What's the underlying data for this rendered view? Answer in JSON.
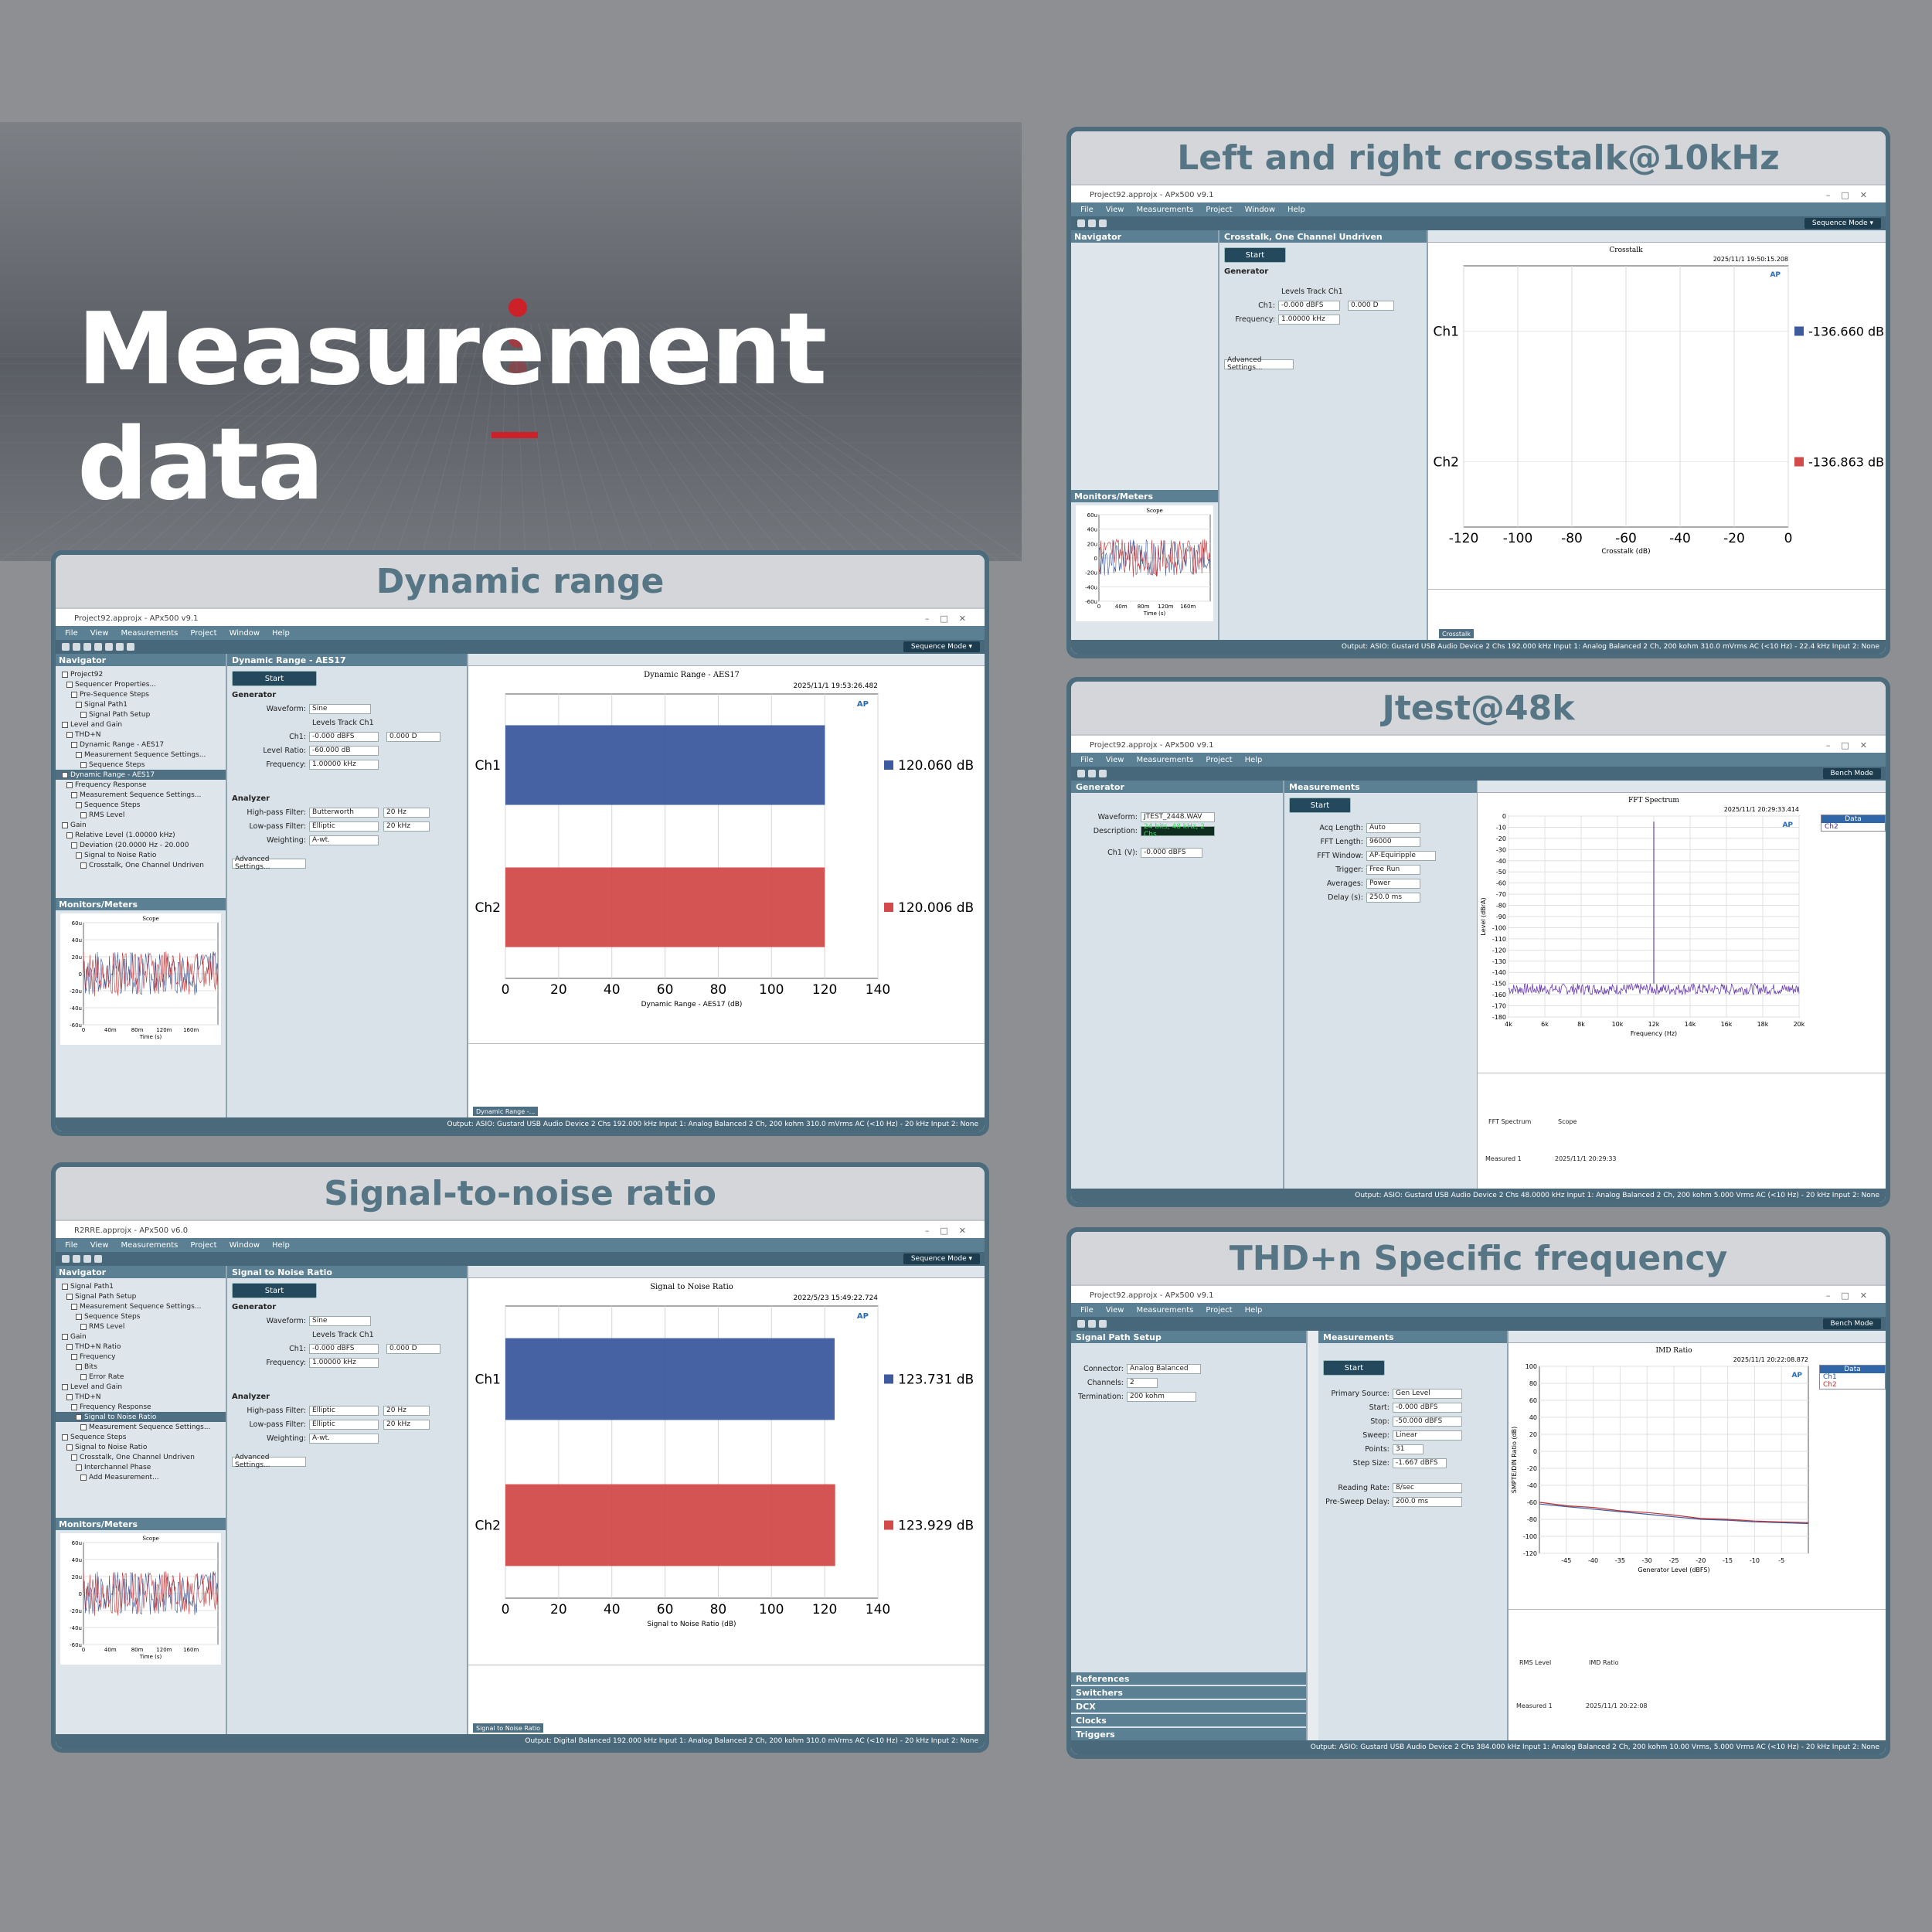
{
  "hero": {
    "title": "Measurement data"
  },
  "panels": {
    "dynamic_range": {
      "heading": "Dynamic range",
      "window_title": "Project92.approjx - APx500 v9.1",
      "nav_header": "Navigator",
      "monitors": "Monitors/Meters",
      "settings_title": "Dynamic Range - AES17",
      "start": "Start",
      "generator": "Generator",
      "waveform": "Sine",
      "levels_track": "Levels Track Ch1",
      "ch1_level": "-0.000 dBFS",
      "dc_offset": "0.000 D",
      "level_ratio": "-60.000 dB",
      "frequency": "1.00000 kHz",
      "analyzer": "Analyzer",
      "hp_filter": "Butterworth",
      "hp_freq": "20 Hz",
      "lp_filter": "Elliptic",
      "lp_freq": "20 kHz",
      "weighting": "A-wt.",
      "advanced": "Advanced Settings...",
      "unit": "dB",
      "thumb_caption": "Dynamic Range -...",
      "status": "Output: ASIO: Gustard USB Audio Device 2 Chs  192.000 kHz  Input 1: Analog Balanced 2 Ch, 200 kohm  310.0 mVrms  AC (<10 Hz) - 20 kHz  Input 2: None",
      "nav_items": [
        "Project92",
        "Sequencer Properties...",
        "Pre-Sequence Steps",
        "Signal Path1",
        "Signal Path Setup",
        "Level and Gain",
        "THD+N",
        "Dynamic Range - AES17",
        "Measurement Sequence Settings...",
        "Sequence Steps",
        "Dynamic Range - AES17",
        "Frequency Response",
        "Measurement Sequence Settings...",
        "Sequence Steps",
        "RMS Level",
        "Gain",
        "Relative Level (1.00000 kHz)",
        "Deviation (20.0000 Hz - 20.000",
        "Signal to Noise Ratio",
        "Crosstalk, One Channel Undriven"
      ]
    },
    "snr": {
      "heading": "Signal-to-noise ratio",
      "window_title": "R2RRE.approjx - APx500 v6.0",
      "settings_title": "Signal to Noise Ratio",
      "hp_filter": "Elliptic",
      "thumb_caption": "Signal to Noise Ratio",
      "status": "Output: Digital Balanced  192.000 kHz  Input 1: Analog Balanced 2 Ch, 200 kohm  310.0 mVrms  AC (<10 Hz) - 20 kHz  Input 2: None",
      "nav_items": [
        "Signal Path1",
        "Signal Path Setup",
        "Measurement Sequence Settings...",
        "Sequence Steps",
        "RMS Level",
        "Gain",
        "THD+N Ratio",
        "Frequency",
        "Bits",
        "Error Rate",
        "Level and Gain",
        "THD+N",
        "Frequency Response",
        "Signal to Noise Ratio",
        "Measurement Sequence Settings...",
        "Sequence Steps",
        "Signal to Noise Ratio",
        "Crosstalk, One Channel Undriven",
        "Interchannel Phase",
        "Add Measurement..."
      ]
    },
    "crosstalk": {
      "heading": "Left and right crosstalk@10kHz",
      "settings_title": "Crosstalk, One Channel Undriven",
      "frequency": "1.00000 kHz",
      "thumb_caption": "Crosstalk",
      "status": "Output: ASIO: Gustard USB Audio Device 2 Chs  192.000 kHz  Input 1: Analog Balanced 2 Ch, 200 kohm  310.0 mVrms  AC (<10 Hz) - 22.4 kHz  Input 2: None"
    },
    "jtest": {
      "heading": "Jtest@48k",
      "mode": "Bench Mode",
      "generator": "Generator",
      "measurements": "Measurements",
      "waveform": "JTEST_2448.WAV",
      "description": "24 bits, 48 kHz, 2 Chs",
      "acq_length": "Auto",
      "fft_length": "96000",
      "fft_window": "AP-Equiripple",
      "trigger": "Free Run",
      "averages": "Power",
      "delay": "250.0 ms",
      "data_legend": [
        "Data",
        "Ch2"
      ],
      "results": [
        "FFT Spectrum",
        "Scope"
      ],
      "data_set": "Measured 1",
      "data_time": "2025/11/1 20:29:33",
      "status": "Output: ASIO: Gustard USB Audio Device 2 Chs  48.0000 kHz  Input 1: Analog Balanced 2 Ch, 200 kohm  5.000 Vrms  AC (<10 Hz) - 20 kHz  Input 2: None"
    },
    "thdn": {
      "heading": "THD+n Specific frequency",
      "mode": "Bench Mode",
      "signal_path": "Signal Path Setup",
      "measurements": "Measurements",
      "connector": "Analog Balanced",
      "channels": "2",
      "termination": "200 kohm",
      "primary_source": "Gen Level",
      "start": "-0.000 dBFS",
      "stop": "-50.000 dBFS",
      "sweep": "Linear",
      "points": "31",
      "step_size": "-1.667 dBFS",
      "reading_rate": "8/sec",
      "pre_sweep_delay": "200.0 ms",
      "data_legend": [
        "Data",
        "Ch1",
        "Ch2"
      ],
      "results": [
        "RMS Level",
        "IMD Ratio"
      ],
      "data_set": "Measured 1",
      "data_time": "2025/11/1 20:22:08",
      "side_links": [
        "References",
        "Switchers",
        "DCX",
        "Clocks",
        "Triggers"
      ],
      "status": "Output: ASIO: Gustard USB Audio Device 2 Chs  384.000 kHz  Input 1: Analog Balanced 2 Ch, 200 kohm  10.00 Vrms, 5.000 Vrms  AC (<10 Hz) - 20 kHz  Input 2: None"
    }
  },
  "menus": [
    "File",
    "View",
    "Measurements",
    "Project",
    "Window",
    "Help"
  ],
  "chart_data": [
    {
      "type": "bar",
      "title": "Dynamic Range - AES17",
      "timestamp": "2025/11/1 19:53:26.482",
      "categories": [
        "Ch1",
        "Ch2"
      ],
      "values": [
        120.06,
        120.006
      ],
      "value_labels": [
        "120.060 dB",
        "120.006 dB"
      ],
      "xlabel": "Dynamic Range - AES17 (dB)",
      "xlim": [
        0,
        140
      ],
      "xticks": [
        0,
        20,
        40,
        60,
        80,
        100,
        120,
        140
      ],
      "colors": [
        "#3d5a9e",
        "#d24a4a"
      ]
    },
    {
      "type": "bar",
      "title": "Signal to Noise Ratio",
      "timestamp": "2022/5/23 15:49:22.724",
      "categories": [
        "Ch1",
        "Ch2"
      ],
      "values": [
        123.731,
        123.929
      ],
      "value_labels": [
        "123.731 dB",
        "123.929 dB"
      ],
      "xlabel": "Signal to Noise Ratio (dB)",
      "xlim": [
        0,
        140
      ],
      "xticks": [
        0,
        20,
        40,
        60,
        80,
        100,
        120,
        140
      ],
      "colors": [
        "#3d5a9e",
        "#d24a4a"
      ]
    },
    {
      "type": "bar",
      "title": "Crosstalk",
      "timestamp": "2025/11/1 19:50:15.208",
      "categories": [
        "Ch1",
        "Ch2"
      ],
      "values": [
        -136.66,
        -136.863
      ],
      "value_labels": [
        "-136.660 dB",
        "-136.863 dB"
      ],
      "xlabel": "Crosstalk (dB)",
      "xlim": [
        -120,
        0
      ],
      "xticks": [
        -120,
        -100,
        -80,
        -60,
        -40,
        -20,
        0
      ],
      "colors": [
        "#3d5a9e",
        "#d24a4a"
      ]
    },
    {
      "type": "line",
      "title": "FFT Spectrum",
      "timestamp": "2025/11/1 20:29:33.414",
      "xlabel": "Frequency (Hz)",
      "ylabel": "Level (dBrA)",
      "x": [
        4000,
        12000,
        20000
      ],
      "xticks": [
        "4k",
        "6k",
        "8k",
        "10k",
        "12k",
        "14k",
        "16k",
        "18k",
        "20k"
      ],
      "ylim": [
        -180,
        0
      ],
      "yticks": [
        0,
        -10,
        -20,
        -30,
        -40,
        -50,
        -60,
        -70,
        -80,
        -90,
        -100,
        -110,
        -120,
        -130,
        -140,
        -150,
        -160,
        -170,
        -180
      ],
      "noise_floor": [
        -160,
        -150
      ],
      "peak": {
        "x": 12000,
        "y": -5
      },
      "series": [
        {
          "name": "Ch2",
          "color": "#6a3fb0"
        }
      ]
    },
    {
      "type": "line",
      "title": "IMD Ratio",
      "timestamp": "2025/11/1 20:22:08.872",
      "xlabel": "Generator Level (dBFS)",
      "ylabel": "SMPTE/DIN Ratio (dB)",
      "xlim": [
        -50,
        0
      ],
      "xticks": [
        -45,
        -40,
        -35,
        -30,
        -25,
        -20,
        -15,
        -10,
        -5
      ],
      "ylim": [
        -120,
        100
      ],
      "yticks": [
        100,
        80,
        60,
        40,
        20,
        0,
        -20,
        -40,
        -60,
        -80,
        -100,
        -120
      ],
      "x": [
        -50,
        -45,
        -40,
        -35,
        -30,
        -25,
        -20,
        -15,
        -10,
        -5,
        0
      ],
      "series": [
        {
          "name": "Ch1",
          "values": [
            -62,
            -65,
            -68,
            -71,
            -74,
            -77,
            -80,
            -81,
            -83,
            -84,
            -85
          ],
          "color": "#3d5a9e"
        },
        {
          "name": "Ch2",
          "values": [
            -60,
            -64,
            -66,
            -70,
            -72,
            -75,
            -79,
            -80,
            -82,
            -83,
            -84
          ],
          "color": "#c03434"
        }
      ]
    },
    {
      "type": "line",
      "title": "Scope",
      "xlabel": "Time (s)",
      "ylabel": "Instantaneous Level (V)",
      "xticks": [
        "0",
        "40m",
        "80m",
        "120m",
        "160m"
      ],
      "yticks": [
        "60u",
        "40u",
        "20u",
        "0",
        "-20u",
        "-40u",
        "-60u"
      ],
      "series": [
        {
          "name": "Ch1",
          "color": "#3d5a9e"
        },
        {
          "name": "Ch2",
          "color": "#c03434"
        }
      ]
    }
  ]
}
